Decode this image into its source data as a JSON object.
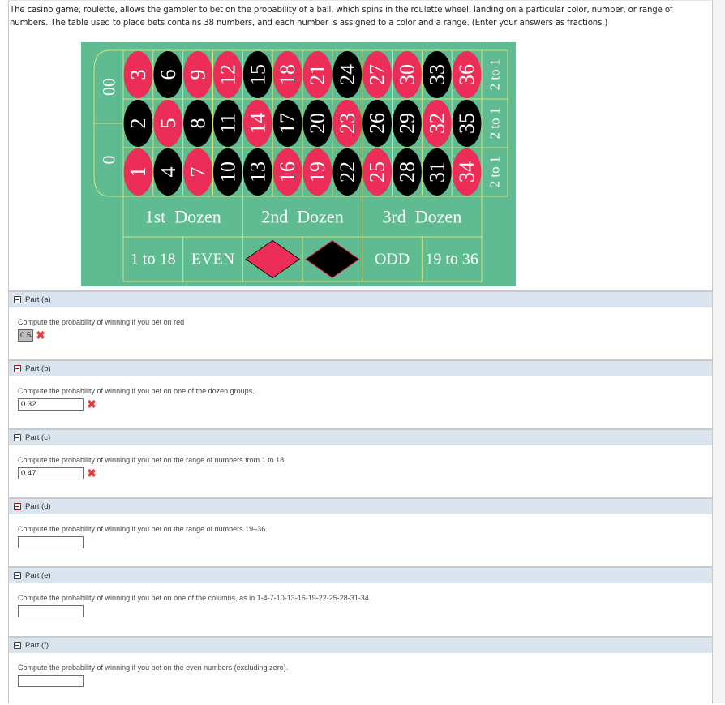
{
  "intro_text": "The casino game, roulette, allows the gambler to bet on the probability of a ball, which spins in the roulette wheel, landing on a particular color, number, or range of numbers. The table used to place bets contains 38 numbers, and each number is assigned to a color and a range. (Enter your answers as fractions.)",
  "board": {
    "zeros": [
      "0",
      "00"
    ],
    "colors": {
      "felt": "#5fbb91",
      "red": "#ec2d57",
      "black": "#000000",
      "line": "#d6e27a",
      "text": "#ffffff"
    },
    "numbers": [
      {
        "n": "1",
        "color": "red"
      },
      {
        "n": "2",
        "color": "black"
      },
      {
        "n": "3",
        "color": "red"
      },
      {
        "n": "4",
        "color": "black"
      },
      {
        "n": "5",
        "color": "red"
      },
      {
        "n": "6",
        "color": "black"
      },
      {
        "n": "7",
        "color": "red"
      },
      {
        "n": "8",
        "color": "black"
      },
      {
        "n": "9",
        "color": "red"
      },
      {
        "n": "10",
        "color": "black"
      },
      {
        "n": "11",
        "color": "black"
      },
      {
        "n": "12",
        "color": "red"
      },
      {
        "n": "13",
        "color": "black"
      },
      {
        "n": "14",
        "color": "red"
      },
      {
        "n": "15",
        "color": "black"
      },
      {
        "n": "16",
        "color": "red"
      },
      {
        "n": "17",
        "color": "black"
      },
      {
        "n": "18",
        "color": "red"
      },
      {
        "n": "19",
        "color": "red"
      },
      {
        "n": "20",
        "color": "black"
      },
      {
        "n": "21",
        "color": "red"
      },
      {
        "n": "22",
        "color": "black"
      },
      {
        "n": "23",
        "color": "red"
      },
      {
        "n": "24",
        "color": "black"
      },
      {
        "n": "25",
        "color": "red"
      },
      {
        "n": "26",
        "color": "black"
      },
      {
        "n": "27",
        "color": "red"
      },
      {
        "n": "28",
        "color": "black"
      },
      {
        "n": "29",
        "color": "black"
      },
      {
        "n": "30",
        "color": "red"
      },
      {
        "n": "31",
        "color": "black"
      },
      {
        "n": "32",
        "color": "red"
      },
      {
        "n": "33",
        "color": "black"
      },
      {
        "n": "34",
        "color": "red"
      },
      {
        "n": "35",
        "color": "black"
      },
      {
        "n": "36",
        "color": "red"
      }
    ],
    "column_bets": [
      "2 to 1",
      "2 to 1",
      "2 to 1"
    ],
    "dozens": [
      "1st  Dozen",
      "2nd  Dozen",
      "3rd  Dozen"
    ],
    "outside_bets": [
      "1 to 18",
      "EVEN",
      "red-diamond",
      "black-diamond",
      "ODD",
      "19 to 36"
    ]
  },
  "parts": [
    {
      "label": "Part (a)",
      "question": "Compute the probability of winning if you bet on red",
      "answer": "0.5",
      "status": "incorrect",
      "status_glyph": "✖"
    },
    {
      "label": "Part (b)",
      "question": "Compute the probability of winning if you bet on one of the dozen groups.",
      "answer": "0.32",
      "status": "incorrect",
      "status_glyph": "✖"
    },
    {
      "label": "Part (c)",
      "question": "Compute the probability of winning if you bet on the range of numbers from 1 to 18.",
      "answer": "0.47",
      "status": "incorrect",
      "status_glyph": "✖"
    },
    {
      "label": "Part (d)",
      "question": "Compute the probability of winning if you bet on the range of numbers 19–36.",
      "answer": "",
      "status": "",
      "status_glyph": ""
    },
    {
      "label": "Part (e)",
      "question": "Compute the probability of winning if you bet on one of the columns, as in 1-4-7-10-13-16-19-22-25-28-31-34.",
      "answer": "",
      "status": "",
      "status_glyph": ""
    },
    {
      "label": "Part (f)",
      "question": "Compute the probability of winning if you bet on the even numbers (excluding zero).",
      "answer": "",
      "status": "",
      "status_glyph": ""
    }
  ]
}
